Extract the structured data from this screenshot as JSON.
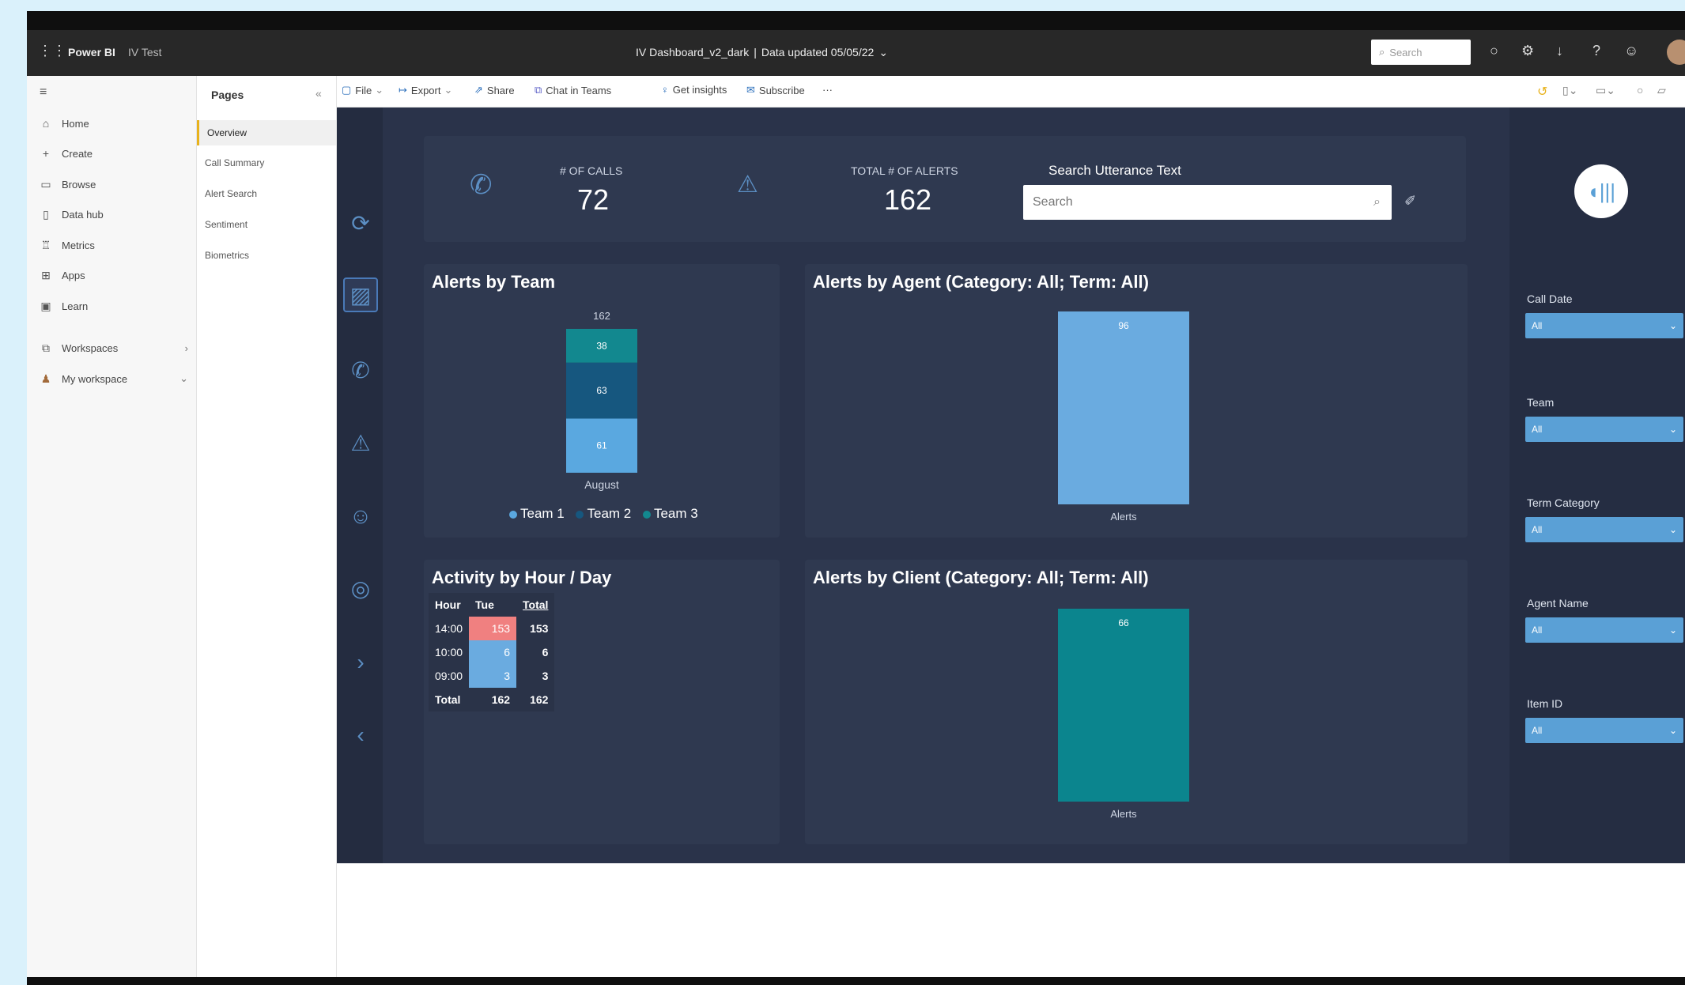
{
  "titlebar": {
    "app": "Power BI",
    "workspace": "IV Test",
    "report": "IV Dashboard_v2_dark",
    "separator": "|",
    "updated": "Data updated 05/05/22",
    "search_placeholder": "Search"
  },
  "nav": {
    "items": [
      {
        "label": "Home",
        "icon": "home-icon"
      },
      {
        "label": "Create",
        "icon": "plus-icon"
      },
      {
        "label": "Browse",
        "icon": "folder-icon"
      },
      {
        "label": "Data hub",
        "icon": "database-icon"
      },
      {
        "label": "Metrics",
        "icon": "trophy-icon"
      },
      {
        "label": "Apps",
        "icon": "apps-icon"
      },
      {
        "label": "Learn",
        "icon": "book-icon"
      }
    ],
    "workspaces": "Workspaces",
    "my_workspace": "My workspace"
  },
  "pages": {
    "header": "Pages",
    "items": [
      "Overview",
      "Call Summary",
      "Alert Search",
      "Sentiment",
      "Biometrics"
    ]
  },
  "toolbar": {
    "file": "File",
    "export": "Export",
    "share": "Share",
    "chat": "Chat in Teams",
    "insights": "Get insights",
    "subscribe": "Subscribe",
    "more": "···"
  },
  "kpis": {
    "calls_label": "# OF CALLS",
    "calls_value": "72",
    "alerts_label": "TOTAL # OF ALERTS",
    "alerts_value": "162",
    "search_title": "Search Utterance Text",
    "search_placeholder": "Search"
  },
  "alerts_by_team": {
    "title": "Alerts by Team",
    "legend": [
      "Team 1",
      "Team 2",
      "Team 3"
    ]
  },
  "alerts_by_agent": {
    "title": "Alerts by Agent (Category: All; Term: All)"
  },
  "activity": {
    "title": "Activity by Hour / Day",
    "headers": [
      "Hour",
      "Tue",
      "Total"
    ],
    "rows": [
      {
        "hour": "14:00",
        "tue": "153",
        "total": "153"
      },
      {
        "hour": "10:00",
        "tue": "6",
        "total": "6"
      },
      {
        "hour": "09:00",
        "tue": "3",
        "total": "3"
      }
    ],
    "total_row": {
      "hour": "Total",
      "tue": "162",
      "total": "162"
    }
  },
  "alerts_by_client": {
    "title": "Alerts by Client (Category: All; Term: All)"
  },
  "filters": [
    {
      "label": "Call Date",
      "value": "All"
    },
    {
      "label": "Team",
      "value": "All"
    },
    {
      "label": "Term Category",
      "value": "All"
    },
    {
      "label": "Agent Name",
      "value": "All"
    },
    {
      "label": "Item ID",
      "value": "All"
    }
  ],
  "chart_data": [
    {
      "type": "bar",
      "title": "Alerts by Team",
      "stacked": true,
      "categories": [
        "August"
      ],
      "total_label": "162",
      "series": [
        {
          "name": "Team 1",
          "values": [
            61
          ],
          "color": "#5aa8e0"
        },
        {
          "name": "Team 2",
          "values": [
            63
          ],
          "color": "#16577f"
        },
        {
          "name": "Team 3",
          "values": [
            38
          ],
          "color": "#12888f"
        }
      ]
    },
    {
      "type": "bar",
      "title": "Alerts by Agent (Category: All; Term: All)",
      "categories": [
        "Alerts"
      ],
      "values": [
        96
      ],
      "color": "#6aabe0"
    },
    {
      "type": "bar",
      "title": "Alerts by Client (Category: All; Term: All)",
      "categories": [
        "Alerts"
      ],
      "values": [
        66
      ],
      "color": "#0b858e"
    }
  ],
  "colors": {
    "canvas": "#2a334a",
    "card": "#2f3950",
    "accent_blue": "#5aa0d6",
    "teal": "#0b858e",
    "heat_high": "#f08080",
    "heat_low": "#6aabe0"
  }
}
